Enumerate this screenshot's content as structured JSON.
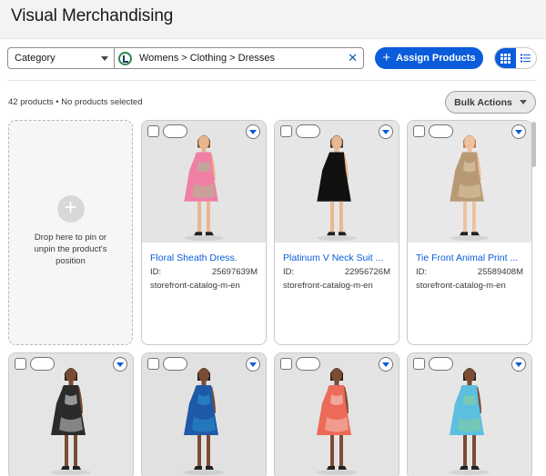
{
  "header": {
    "title": "Visual Merchandising"
  },
  "toolbar": {
    "category_label": "Category",
    "category_path": "Womens > Clothing > Dresses",
    "clear_label": "✕",
    "assign_label": "Assign Products",
    "assign_icon": "+"
  },
  "summary": {
    "count_text": "42 products • No products selected",
    "bulk_label": "Bulk Actions"
  },
  "dropzone": {
    "plus": "+",
    "text": "Drop here to pin or unpin the product's position"
  },
  "products": [
    {
      "name": "Floral Sheath Dress.",
      "id_label": "ID:",
      "id": "25697639M",
      "catalog": "storefront-catalog-m-en",
      "bg": "#e4e4e4",
      "dress": "#f07fa6",
      "accent": "#9bc98a",
      "skin": "#e9b58f",
      "hair": "#6e4a2c"
    },
    {
      "name": "Platinum V Neck Suit ...",
      "id_label": "ID:",
      "id": "22956726M",
      "catalog": "storefront-catalog-m-en",
      "bg": "#e6e6e6",
      "dress": "#111111",
      "accent": "#111111",
      "skin": "#e7b792",
      "hair": "#3a2a1e"
    },
    {
      "name": "Tie Front Animal Print ...",
      "id_label": "ID:",
      "id": "25589408M",
      "catalog": "storefront-catalog-m-en",
      "bg": "#e8e8e8",
      "dress": "#b79a74",
      "accent": "#e6d4b4",
      "skin": "#edc2a0",
      "hair": "#c3733e"
    },
    {
      "name": "",
      "bg": "#e5e5e5",
      "dress": "#2b2b2b",
      "accent": "#f1f1f1",
      "skin": "#7a4c33",
      "hair": "#231a15"
    },
    {
      "name": "",
      "bg": "#e1e1e1",
      "dress": "#1e5aa8",
      "accent": "#2e9bd6",
      "skin": "#7a4c33",
      "hair": "#231a15"
    },
    {
      "name": "",
      "bg": "#e3e3e3",
      "dress": "#ec6a58",
      "accent": "#f7d6cf",
      "skin": "#7a4c33",
      "hair": "#231a15"
    },
    {
      "name": "",
      "bg": "#e6e6e6",
      "dress": "#5bbfe0",
      "accent": "#8fd18a",
      "skin": "#7a4c33",
      "hair": "#231a15"
    }
  ],
  "icons": {
    "category_caret": "chevron-down-icon",
    "path_logo": "catalog-logo-icon",
    "clear": "close-icon",
    "assign": "plus-icon",
    "grid_view": "grid-icon",
    "list_view": "list-icon",
    "bulk_caret": "chevron-down-icon",
    "drop_plus": "plus-icon",
    "card_menu": "chevron-down-icon"
  },
  "colors": {
    "brand_blue": "#0b5cdb",
    "link_blue": "#0b5cdb",
    "page_bg": "#f3f3f3"
  }
}
